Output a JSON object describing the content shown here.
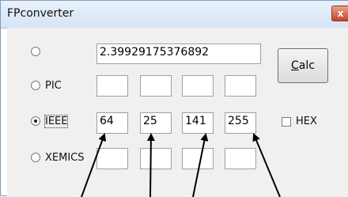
{
  "window": {
    "title": "FPconverter",
    "close_glyph": "x"
  },
  "main": {
    "float_value": "2.39929175376892",
    "calc_label": "Calc",
    "calc_mnemonic": "C",
    "calc_rest": "alc",
    "hex_label": "HEX",
    "rows": [
      {
        "label": "",
        "checked": false
      },
      {
        "label": "PIC",
        "checked": false,
        "bytes": [
          "",
          "",
          "",
          ""
        ]
      },
      {
        "label": "IEEE",
        "checked": true,
        "bytes": [
          "64",
          "25",
          "141",
          "255"
        ]
      },
      {
        "label": "XEMICS",
        "checked": false,
        "bytes": [
          "",
          "",
          "",
          ""
        ]
      }
    ]
  }
}
